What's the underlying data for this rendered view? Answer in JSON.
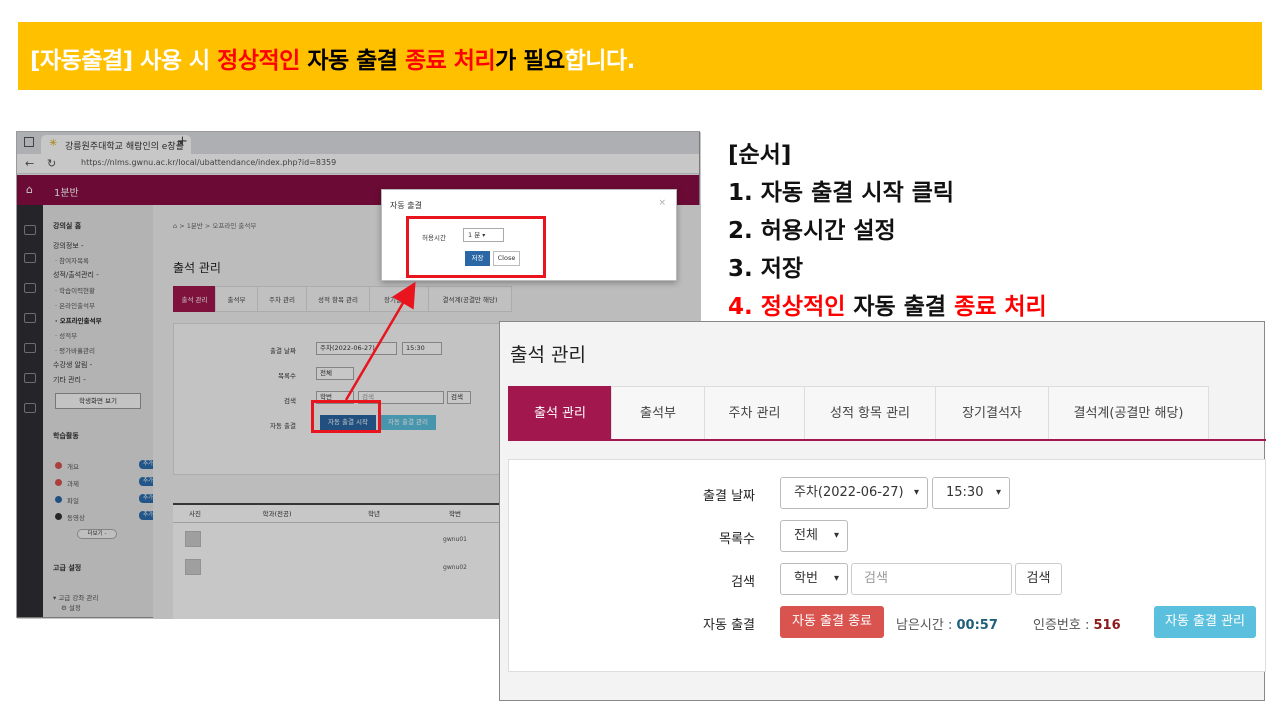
{
  "banner": {
    "part1": "[자동출결] 사용 시 ",
    "part2": "정상적인",
    "part3": " 자동 출결 ",
    "part4": "종료 처리",
    "part5": "가 필요",
    "part6": "합니다."
  },
  "steps": {
    "heading": "[순서]",
    "step1": "1.  자동 출결 시작 클릭",
    "step2": "2.  허용시간 설정",
    "step3": "3.  저장",
    "step4_num": "4.  ",
    "step4_a": "정상적인",
    "step4_b": " 자동 출결 ",
    "step4_c": "종료 처리"
  },
  "browser": {
    "tab_title": "강릉원주대학교 해람인의 e창플",
    "url": "https://nlms.gwnu.ac.kr/local/ubattendance/index.php?id=8359",
    "course_name": "1분반",
    "left": {
      "section1": "강의실 홈",
      "items": [
        "강의정보 -",
        "· 참여자목록",
        "성적/출석관리 -",
        "· 학습이력현황",
        "· 온라인출석부",
        "· 오프라인출석부",
        "· 성적부",
        "· 평가바흘관리",
        "수강생 알림 -",
        "기타 관리 -"
      ],
      "student_view_btn": "학생화면 보기",
      "section2": "학습활동",
      "activities": [
        {
          "label": "개요",
          "badge": "추가",
          "color": "#d9534f"
        },
        {
          "label": "과제",
          "badge": "추가",
          "color": "#d9534f"
        },
        {
          "label": "파일",
          "badge": "추가",
          "color": "#2b67a5"
        },
        {
          "label": "동영상",
          "badge": "추가",
          "color": "#333333"
        }
      ],
      "more": "더보기 -",
      "section3": "고급 설정",
      "advanced_item": "▾ 고급 강좌 관리",
      "advanced_sub": "⚙ 설정"
    },
    "main": {
      "breadcrumb": "⌂  >  1분반  >  오프라인 출석부",
      "title": "출석 관리",
      "tabs": [
        "출석 관리",
        "출석부",
        "주차 관리",
        "성적 항목 관리",
        "장기결석자",
        "결석계(공결만 해당)"
      ],
      "form": {
        "date_label": "출결 날짜",
        "week_value": "주차(2022-06-27)",
        "time_value": "15:30",
        "list_label": "목록수",
        "list_value": "전체",
        "search_label": "검색",
        "search_field": "학번",
        "search_placeholder": "검색",
        "search_btn": "검색",
        "auto_label": "자동 출결",
        "auto_start_btn": "자동 출결 시작",
        "auto_manage_btn": "자동 출결 관리"
      },
      "table_headers": [
        "사진",
        "학과(전공)",
        "학년",
        "학번"
      ],
      "rows": [
        {
          "id": "gwnu01"
        },
        {
          "id": "gwnu02"
        }
      ]
    },
    "modal": {
      "title": "자동 출결",
      "close_icon": "×",
      "allow_label": "허용시간",
      "allow_value": "1 분",
      "save_btn": "저장",
      "close_btn": "Close"
    }
  },
  "zoom": {
    "title": "출석 관리",
    "tabs": [
      "출석 관리",
      "출석부",
      "주차 관리",
      "성적 항목 관리",
      "장기결석자",
      "결석계(공결만 해당)"
    ],
    "date_label": "출결 날짜",
    "week_value": "주차(2022-06-27)",
    "time_value": "15:30",
    "list_label": "목록수",
    "list_value": "전체",
    "search_label": "검색",
    "search_field": "학번",
    "search_placeholder": "검색",
    "search_btn": "검색",
    "auto_label": "자동 출결",
    "auto_stop_btn": "자동 출결 종료",
    "remaining_label": "남은시간 :",
    "remaining_value": "00:57",
    "auth_label": "인증번호 :",
    "auth_value": "516",
    "auto_manage_btn": "자동 출결 관리"
  },
  "colors": {
    "banner_bg": "#ffc000",
    "brand": "#a3174f",
    "highlight": "#e8141e",
    "danger": "#d9534f",
    "info": "#5bc0de",
    "primary": "#2b67a5"
  }
}
